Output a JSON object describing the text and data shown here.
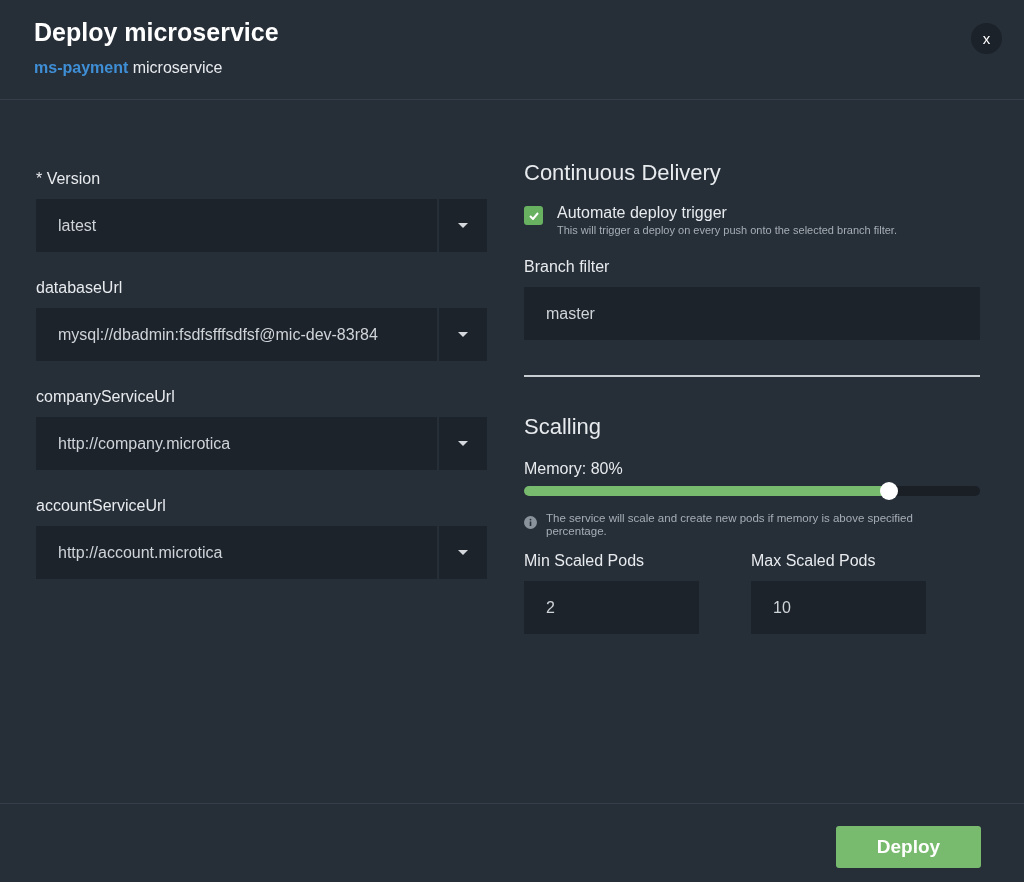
{
  "dialog": {
    "title": "Deploy microservice",
    "service_name": "ms-payment",
    "service_suffix": "microservice",
    "close": "x"
  },
  "fields": [
    {
      "label": "* Version",
      "value": "latest"
    },
    {
      "label": "databaseUrl",
      "value": "mysql://dbadmin:fsdfsfffsdfsf@mic-dev-83r84"
    },
    {
      "label": "companyServiceUrl",
      "value": "http://company.microtica"
    },
    {
      "label": "accountServiceUrl",
      "value": "http://account.microtica"
    }
  ],
  "continuous_delivery": {
    "heading": "Continuous Delivery",
    "automate": {
      "label": "Automate deploy trigger",
      "hint": "This will trigger a deploy on every push onto the selected branch filter.",
      "checked": true
    },
    "branch_label": "Branch filter",
    "branch_value": "master"
  },
  "scaling": {
    "heading": "Scalling",
    "memory_label": "Memory: 80%",
    "level": 0.8,
    "info": "The service will scale and create new pods if memory is above specified percentage.",
    "min_label": "Min Scaled Pods",
    "min_value": "2",
    "max_label": "Max Scaled Pods",
    "max_value": "10"
  },
  "footer": {
    "deploy": "Deploy"
  }
}
